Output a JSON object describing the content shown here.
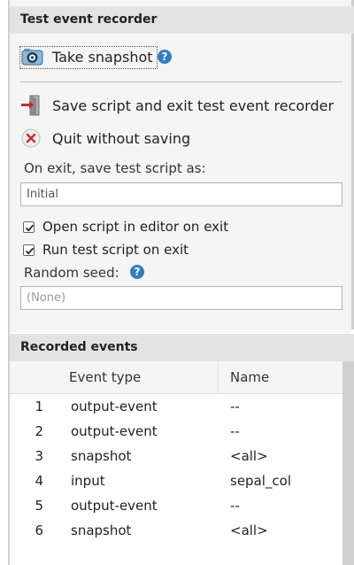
{
  "recorder": {
    "title": "Test event recorder",
    "snapshot_label": "Take snapshot",
    "save_exit_label": "Save script and exit test event recorder",
    "quit_label": "Quit without saving",
    "save_as_label": "On exit, save test script as:",
    "save_as_value": "Initial",
    "open_in_editor_label": "Open script in editor on exit",
    "open_in_editor_checked": true,
    "run_on_exit_label": "Run test script on exit",
    "run_on_exit_checked": true,
    "seed_label": "Random seed:",
    "seed_placeholder": "(None)",
    "help_glyph": "?"
  },
  "events": {
    "title": "Recorded events",
    "columns": {
      "num": "",
      "type": "Event type",
      "name": "Name"
    },
    "rows": [
      {
        "num": "1",
        "type": "output-event",
        "name": "--"
      },
      {
        "num": "2",
        "type": "output-event",
        "name": "--"
      },
      {
        "num": "3",
        "type": "snapshot",
        "name": "<all>"
      },
      {
        "num": "4",
        "type": "input",
        "name": "sepal_col"
      },
      {
        "num": "5",
        "type": "output-event",
        "name": "--"
      },
      {
        "num": "6",
        "type": "snapshot",
        "name": "<all>"
      }
    ]
  },
  "icons": {
    "snapshot": "camera-icon",
    "save_exit": "exit-door-icon",
    "quit": "close-circle-icon",
    "help": "help-icon"
  },
  "colors": {
    "help_blue": "#2f7ec1",
    "quit_red": "#d9232d",
    "exit_red": "#c62828"
  }
}
